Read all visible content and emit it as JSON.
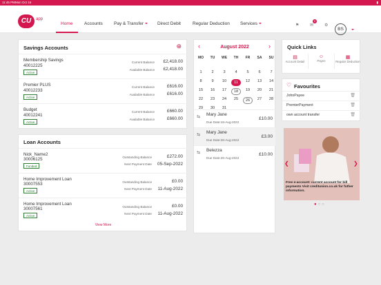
{
  "status": {
    "time": "11:45 PM",
    "date": "Mon Oct 16",
    "battery": "▮"
  },
  "nav": {
    "logo": "CU",
    "logo_suffix": "app",
    "items": [
      {
        "label": "Home"
      },
      {
        "label": "Accounts"
      },
      {
        "label": "Pay & Transfer"
      },
      {
        "label": "Direct Debit"
      },
      {
        "label": "Regular Deduction"
      },
      {
        "label": "Services"
      }
    ],
    "badge": "0",
    "avatar": "BS"
  },
  "savings": {
    "title": "Savings Accounts",
    "add": "⊕",
    "accounts": [
      {
        "name": "Membership Savings",
        "number": "40012225",
        "status": "Active",
        "current_label": "Current Balance",
        "current": "£2,418.00",
        "available_label": "Available Balance",
        "available": "£2,418.00"
      },
      {
        "name": "Premier PLUS",
        "number": "40012233",
        "status": "Active",
        "current_label": "Current Balance",
        "current": "£616.00",
        "available_label": "Available Balance",
        "available": "£616.00"
      },
      {
        "name": "Budget",
        "number": "40012241",
        "status": "Active",
        "current_label": "Current Balance",
        "current": "£660.00",
        "available_label": "Available Balance",
        "available": "£660.00"
      }
    ]
  },
  "loans": {
    "title": "Loan Accounts",
    "view_more": "View More",
    "accounts": [
      {
        "name": "Nick_Name2",
        "number": "30006125",
        "status": "Funded",
        "outstanding_label": "Outstanding Balance",
        "outstanding": "£272.00",
        "next_label": "Next Payment Date",
        "next": "05-Sep-2022"
      },
      {
        "name": "Home Improvement Loan",
        "number": "30007553",
        "status": "Active",
        "outstanding_label": "Outstanding Balance",
        "outstanding": "£0.00",
        "next_label": "Next Payment Date",
        "next": "11-Aug-2022"
      },
      {
        "name": "Home Improvement Loan",
        "number": "30007561",
        "status": "Active",
        "outstanding_label": "Outstanding Balance",
        "outstanding": "£0.00",
        "next_label": "Next Payment Date",
        "next": "11-Aug-2022"
      }
    ]
  },
  "calendar": {
    "month": "August 2022",
    "prev": "‹",
    "next": "›",
    "weekdays": [
      "MO",
      "TU",
      "WE",
      "TH",
      "FR",
      "SA",
      "SU"
    ],
    "weeks": [
      [
        "1",
        "2",
        "3",
        "4",
        "5",
        "6",
        "7"
      ],
      [
        "8",
        "9",
        "10",
        "11",
        "12",
        "13",
        "14"
      ],
      [
        "15",
        "16",
        "17",
        "18",
        "19",
        "20",
        "21"
      ],
      [
        "22",
        "23",
        "24",
        "25",
        "26",
        "27",
        "28"
      ],
      [
        "29",
        "30",
        "31",
        "",
        "",
        "",
        ""
      ]
    ],
    "payments": [
      {
        "name": "Mary Jane",
        "date": "Due Date:18-Aug-2022",
        "amount": "£10.00"
      },
      {
        "name": "Mary Jane",
        "date": "Due Date:28-Aug-2022",
        "amount": "£3.00"
      },
      {
        "name": "Belezza",
        "date": "Due Date:26-Aug-2022",
        "amount": "£10.00"
      }
    ]
  },
  "quick_links": {
    "title": "Quick Links",
    "items": [
      {
        "label": "Account Detail"
      },
      {
        "label": "Payee"
      },
      {
        "label": "Regular Deduction"
      }
    ]
  },
  "favourites": {
    "title": "Favourites",
    "items": [
      "JohnPayee",
      "PremierPayment",
      "own account transfer"
    ]
  },
  "promo": {
    "text": "Free e-account: current account for bill payments Visit creditunion.co.uk for futher information."
  }
}
